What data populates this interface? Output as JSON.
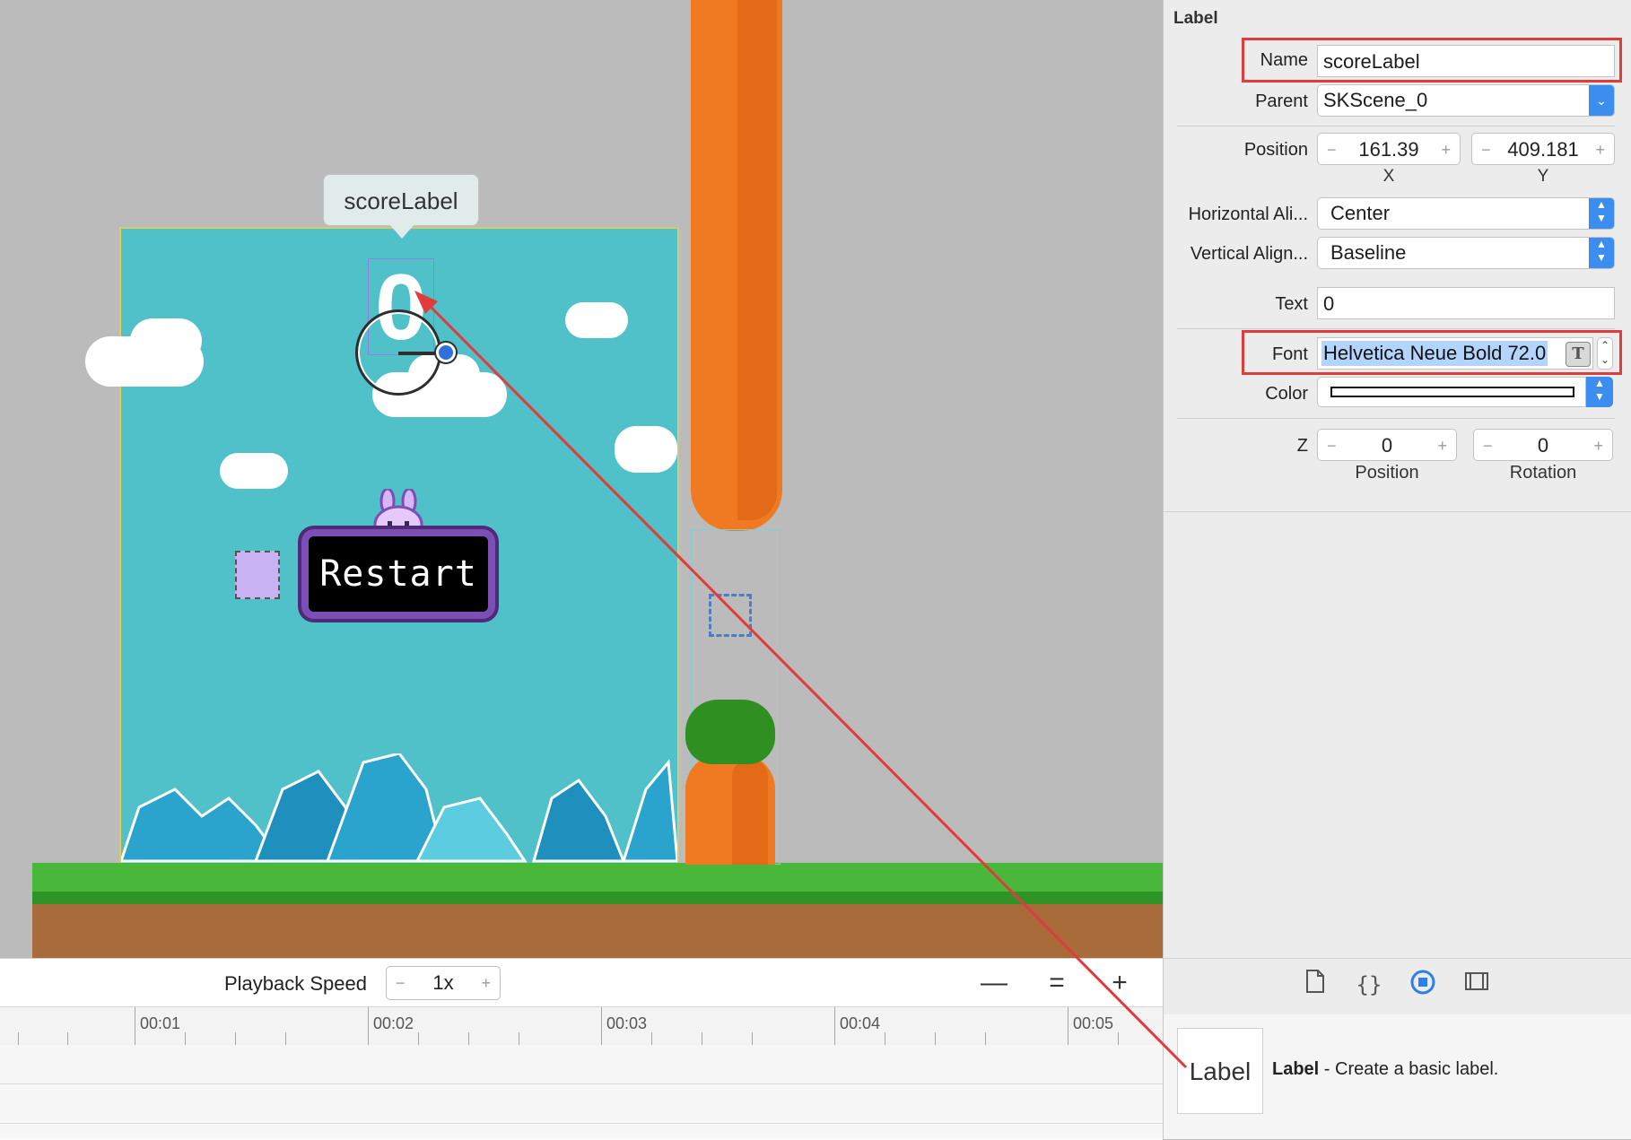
{
  "scene": {
    "tooltip": "scoreLabel",
    "score_text": "0",
    "restart_label": "Restart"
  },
  "timeline": {
    "playback_label": "Playback Speed",
    "speed": {
      "minus": "−",
      "value": "1x",
      "plus": "+"
    },
    "zoom_out": "—",
    "zoom_fit": "=",
    "zoom_in": "+",
    "ticks": [
      "00:01",
      "00:02",
      "00:03",
      "00:04",
      "00:05"
    ]
  },
  "inspector": {
    "title": "Label",
    "name_label": "Name",
    "name_value": "scoreLabel",
    "parent_label": "Parent",
    "parent_value": "SKScene_0",
    "position_label": "Position",
    "position_x": "161.39",
    "position_y": "409.181",
    "x_label": "X",
    "y_label": "Y",
    "halign_label": "Horizontal Ali...",
    "halign_value": "Center",
    "valign_label": "Vertical Align...",
    "valign_value": "Baseline",
    "text_label": "Text",
    "text_value": "0",
    "font_label": "Font",
    "font_value": "Helvetica Neue Bold 72.0",
    "color_label": "Color",
    "z_label": "Z",
    "z_position": "0",
    "z_rotation": "0",
    "z_position_label": "Position",
    "z_rotation_label": "Rotation",
    "stepper_minus": "−",
    "stepper_plus": "+"
  },
  "library": {
    "thumb_text": "Label",
    "item_title": "Label",
    "item_desc": " - Create a basic label."
  },
  "colors": {
    "highlight": "#e23b3b",
    "accent": "#3c8df0",
    "sky": "#50c0c9"
  },
  "icons": [
    "file-icon",
    "braces-icon",
    "object-library-icon",
    "media-library-icon",
    "chevron-updown-icon",
    "font-picker-icon"
  ]
}
